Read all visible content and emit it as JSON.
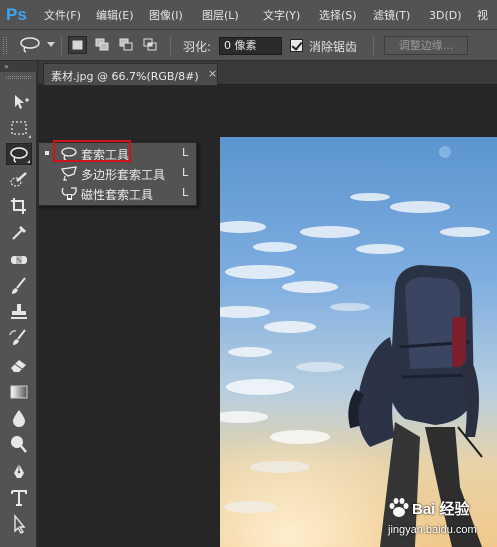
{
  "app": {
    "logo_text": "Ps",
    "accent_color": "#3fa4f2",
    "highlight_color": "#d0121b"
  },
  "menu": {
    "items": [
      {
        "label": "文件(F)"
      },
      {
        "label": "编辑(E)"
      },
      {
        "label": "图像(I)"
      },
      {
        "label": "图层(L)"
      },
      {
        "label": "文字(Y)"
      },
      {
        "label": "选择(S)"
      },
      {
        "label": "滤镜(T)"
      },
      {
        "label": "3D(D)"
      },
      {
        "label": "视"
      }
    ]
  },
  "options_bar": {
    "tool_icon": "lasso-icon",
    "selection_modes": [
      "new-selection-icon",
      "add-to-selection-icon",
      "subtract-from-selection-icon",
      "intersect-selection-icon"
    ],
    "active_mode": "new-selection-icon",
    "feather_label": "羽化:",
    "feather_value": "0 像素",
    "antialias_label": "消除锯齿",
    "antialias_checked": true,
    "refine_edge_label": "调整边缘..."
  },
  "toolbar": {
    "collapse_glyph": "»",
    "active_tool": "lasso-tool-icon",
    "tools": [
      "move-tool-icon",
      "rectangular-marquee-icon",
      "lasso-tool-icon",
      "quick-selection-icon",
      "crop-tool-icon",
      "eyedropper-icon",
      "spot-healing-icon",
      "brush-tool-icon",
      "clone-stamp-icon",
      "history-brush-icon",
      "eraser-icon",
      "gradient-icon",
      "blur-icon",
      "dodge-icon",
      "pen-tool-icon",
      "type-tool-icon",
      "path-selection-icon"
    ]
  },
  "document": {
    "tab_title": "素材.jpg @ 66.7%(RGB/8#)",
    "close_glyph": "×"
  },
  "flyout": {
    "items": [
      {
        "label": "套索工具",
        "shortcut": "L",
        "icon": "lasso-icon",
        "selected": true
      },
      {
        "label": "多边形套索工具",
        "shortcut": "L",
        "icon": "polygonal-lasso-icon",
        "selected": false
      },
      {
        "label": "磁性套索工具",
        "shortcut": "L",
        "icon": "magnetic-lasso-icon",
        "selected": false
      }
    ]
  },
  "watermark": {
    "text": "Bai 经验",
    "url": "jingyan.baidu.com"
  }
}
